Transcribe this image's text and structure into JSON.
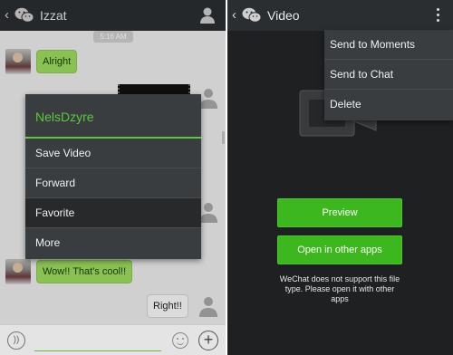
{
  "chat": {
    "contact_name": "Izzat",
    "timestamp": "5:16 AM",
    "messages": [
      {
        "sender": "other",
        "text": "Alright"
      },
      {
        "sender": "other",
        "text": "Wow!! That's cool!!"
      },
      {
        "sender": "self",
        "text": "Right!!"
      }
    ],
    "context_menu": {
      "title": "NelsDzyre",
      "items": [
        {
          "label": "Save Video"
        },
        {
          "label": "Forward"
        },
        {
          "label": "Favorite"
        },
        {
          "label": "More"
        }
      ]
    }
  },
  "video": {
    "title": "Video",
    "menu": [
      {
        "label": "Send to Moments"
      },
      {
        "label": "Send to Chat"
      },
      {
        "label": "Delete"
      }
    ],
    "preview_label": "Preview",
    "open_label": "Open in other apps",
    "notice": "WeChat does not support this file type. Please open it with other apps"
  },
  "colors": {
    "accent_green": "#3cb81e",
    "menu_title_green": "#5bc93b",
    "bubble_green": "#9ddc5e",
    "dark_bar": "#2b2e31",
    "menu_bg": "#3a3d40"
  },
  "icons": {
    "back": "chevron-left-icon",
    "app_logo": "wechat-logo-icon",
    "profile": "person-icon",
    "overflow": "more-vertical-icon",
    "voice": "voice-icon",
    "emoji": "emoji-icon",
    "add": "plus-icon",
    "file": "video-camera-icon"
  }
}
